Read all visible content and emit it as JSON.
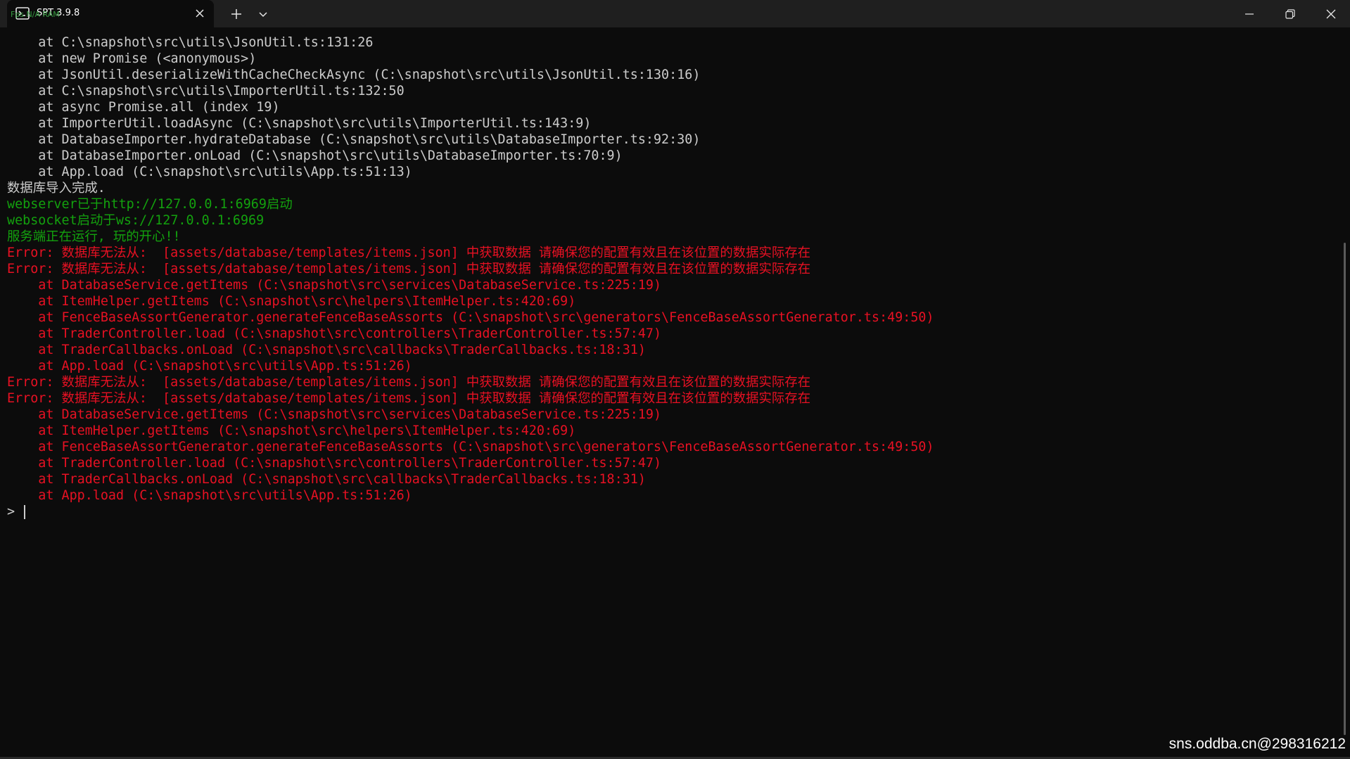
{
  "window": {
    "tab_title": "SPT 3.9.8",
    "tab_overlay_text": "Fps N/A RAM",
    "tab_icon": "terminal-icon",
    "close_tab_icon": "close-icon",
    "new_tab_icon": "plus-icon",
    "dropdown_icon": "chevron-down-icon",
    "minimize_icon": "minimize-icon",
    "maximize_icon": "restore-icon",
    "close_window_icon": "close-icon"
  },
  "colors": {
    "background": "#0c0c0c",
    "titlebar": "#1f1f1f",
    "text_default": "#cccccc",
    "text_success": "#13a10e",
    "text_error": "#e81123"
  },
  "console": {
    "lines": [
      {
        "text": "    at C:\\snapshot\\src\\utils\\JsonUtil.ts:131:26",
        "color": "white"
      },
      {
        "text": "    at new Promise (<anonymous>)",
        "color": "white"
      },
      {
        "text": "    at JsonUtil.deserializeWithCacheCheckAsync (C:\\snapshot\\src\\utils\\JsonUtil.ts:130:16)",
        "color": "white"
      },
      {
        "text": "    at C:\\snapshot\\src\\utils\\ImporterUtil.ts:132:50",
        "color": "white"
      },
      {
        "text": "    at async Promise.all (index 19)",
        "color": "white"
      },
      {
        "text": "    at ImporterUtil.loadAsync (C:\\snapshot\\src\\utils\\ImporterUtil.ts:143:9)",
        "color": "white"
      },
      {
        "text": "    at DatabaseImporter.hydrateDatabase (C:\\snapshot\\src\\utils\\DatabaseImporter.ts:92:30)",
        "color": "white"
      },
      {
        "text": "    at DatabaseImporter.onLoad (C:\\snapshot\\src\\utils\\DatabaseImporter.ts:70:9)",
        "color": "white"
      },
      {
        "text": "    at App.load (C:\\snapshot\\src\\utils\\App.ts:51:13)",
        "color": "white"
      },
      {
        "text": "数据库导入完成.",
        "color": "white"
      },
      {
        "text": "webserver已于http://127.0.0.1:6969启动",
        "color": "green"
      },
      {
        "text": "websocket启动于ws://127.0.0.1:6969",
        "color": "green"
      },
      {
        "text": "服务端正在运行, 玩的开心!!",
        "color": "green"
      },
      {
        "text": "Error: 数据库无法从:  [assets/database/templates/items.json] 中获取数据 请确保您的配置有效且在该位置的数据实际存在",
        "color": "red"
      },
      {
        "text": "Error: 数据库无法从:  [assets/database/templates/items.json] 中获取数据 请确保您的配置有效且在该位置的数据实际存在",
        "color": "red"
      },
      {
        "text": "    at DatabaseService.getItems (C:\\snapshot\\src\\services\\DatabaseService.ts:225:19)",
        "color": "red"
      },
      {
        "text": "    at ItemHelper.getItems (C:\\snapshot\\src\\helpers\\ItemHelper.ts:420:69)",
        "color": "red"
      },
      {
        "text": "    at FenceBaseAssortGenerator.generateFenceBaseAssorts (C:\\snapshot\\src\\generators\\FenceBaseAssortGenerator.ts:49:50)",
        "color": "red"
      },
      {
        "text": "    at TraderController.load (C:\\snapshot\\src\\controllers\\TraderController.ts:57:47)",
        "color": "red"
      },
      {
        "text": "    at TraderCallbacks.onLoad (C:\\snapshot\\src\\callbacks\\TraderCallbacks.ts:18:31)",
        "color": "red"
      },
      {
        "text": "    at App.load (C:\\snapshot\\src\\utils\\App.ts:51:26)",
        "color": "red"
      },
      {
        "text": "Error: 数据库无法从:  [assets/database/templates/items.json] 中获取数据 请确保您的配置有效且在该位置的数据实际存在",
        "color": "red"
      },
      {
        "text": "Error: 数据库无法从:  [assets/database/templates/items.json] 中获取数据 请确保您的配置有效且在该位置的数据实际存在",
        "color": "red"
      },
      {
        "text": "    at DatabaseService.getItems (C:\\snapshot\\src\\services\\DatabaseService.ts:225:19)",
        "color": "red"
      },
      {
        "text": "    at ItemHelper.getItems (C:\\snapshot\\src\\helpers\\ItemHelper.ts:420:69)",
        "color": "red"
      },
      {
        "text": "    at FenceBaseAssortGenerator.generateFenceBaseAssorts (C:\\snapshot\\src\\generators\\FenceBaseAssortGenerator.ts:49:50)",
        "color": "red"
      },
      {
        "text": "    at TraderController.load (C:\\snapshot\\src\\controllers\\TraderController.ts:57:47)",
        "color": "red"
      },
      {
        "text": "    at TraderCallbacks.onLoad (C:\\snapshot\\src\\callbacks\\TraderCallbacks.ts:18:31)",
        "color": "red"
      },
      {
        "text": "    at App.load (C:\\snapshot\\src\\utils\\App.ts:51:26)",
        "color": "red"
      }
    ],
    "prompt": "> "
  },
  "watermark": "sns.oddba.cn@298316212"
}
